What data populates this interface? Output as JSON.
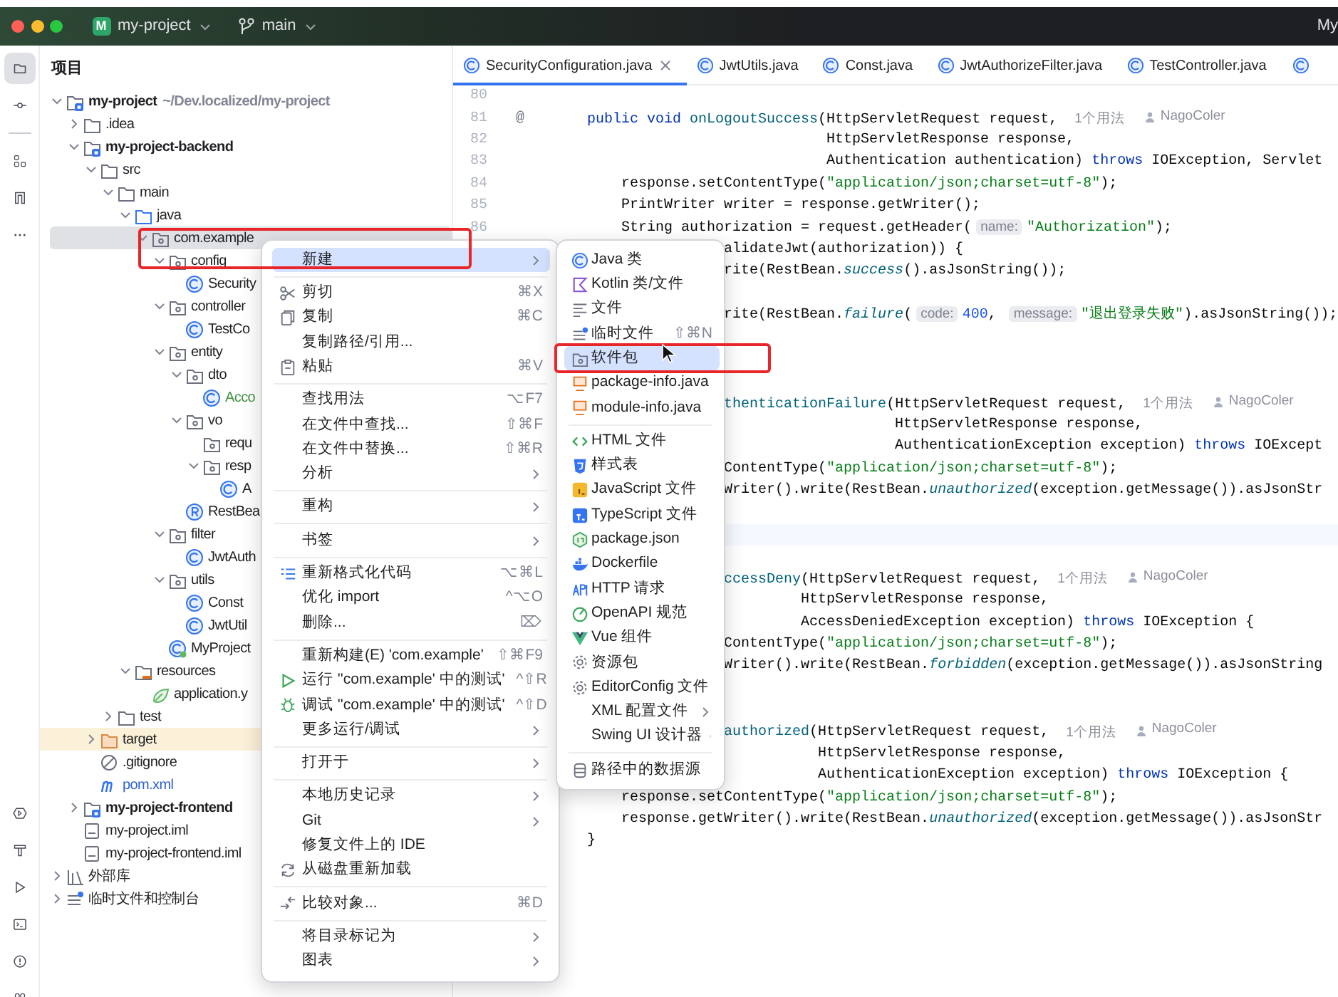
{
  "window": {
    "project_badge": "M",
    "project": "my-project",
    "branch": "main",
    "right_label": "My"
  },
  "tool_strip": {
    "top": [
      {
        "kind": "project",
        "selected": true
      },
      {
        "kind": "commit",
        "selected": false
      },
      {
        "kind": "separator"
      },
      {
        "kind": "structure",
        "selected": false
      },
      {
        "kind": "bookmarks",
        "selected": false
      },
      {
        "kind": "more",
        "selected": false
      }
    ],
    "bottom": [
      {
        "kind": "services",
        "selected": false
      },
      {
        "kind": "build",
        "selected": false
      },
      {
        "kind": "run",
        "selected": false
      },
      {
        "kind": "terminal",
        "selected": false
      },
      {
        "kind": "problems",
        "selected": false
      },
      {
        "kind": "people",
        "selected": false
      }
    ]
  },
  "project_panel": {
    "title": "项目",
    "tree": [
      {
        "label": "my-project",
        "kind": "module",
        "note": "~/Dev.localized/my-project",
        "expanded": true,
        "selected": false,
        "children": [
          {
            "label": ".idea",
            "kind": "folder",
            "expanded": false,
            "selected": false
          },
          {
            "label": "my-project-backend",
            "kind": "module",
            "expanded": true,
            "selected": false,
            "children": [
              {
                "label": "src",
                "kind": "folder",
                "expanded": true,
                "selected": false,
                "children": [
                  {
                    "label": "main",
                    "kind": "folder",
                    "expanded": true,
                    "selected": false,
                    "children": [
                      {
                        "label": "java",
                        "kind": "source",
                        "expanded": true,
                        "selected": false,
                        "children": [
                          {
                            "label": "com.example",
                            "kind": "package",
                            "expanded": true,
                            "selected": true,
                            "children": [
                              {
                                "label": "config",
                                "kind": "package",
                                "expanded": true,
                                "selected": false,
                                "children": [
                                  {
                                    "label": "Security",
                                    "kind": "class",
                                    "selected": false
                                  }
                                ]
                              },
                              {
                                "label": "controller",
                                "kind": "package",
                                "expanded": true,
                                "selected": false,
                                "children": [
                                  {
                                    "label": "TestCo",
                                    "kind": "class",
                                    "selected": false
                                  }
                                ]
                              },
                              {
                                "label": "entity",
                                "kind": "package",
                                "expanded": true,
                                "selected": false,
                                "children": [
                                  {
                                    "label": "dto",
                                    "kind": "package",
                                    "expanded": true,
                                    "selected": false,
                                    "children": [
                                      {
                                        "label": "Acco",
                                        "kind": "class",
                                        "color": "#3f8f3f",
                                        "selected": false
                                      }
                                    ]
                                  },
                                  {
                                    "label": "vo",
                                    "kind": "package",
                                    "expanded": true,
                                    "selected": false,
                                    "children": [
                                      {
                                        "label": "requ",
                                        "kind": "package",
                                        "selected": false
                                      },
                                      {
                                        "label": "resp",
                                        "kind": "package",
                                        "expanded": true,
                                        "selected": false,
                                        "children": [
                                          {
                                            "label": "A",
                                            "kind": "class",
                                            "selected": false
                                          }
                                        ]
                                      }
                                    ]
                                  },
                                  {
                                    "label": "RestBea",
                                    "kind": "record",
                                    "selected": false
                                  }
                                ]
                              },
                              {
                                "label": "filter",
                                "kind": "package",
                                "expanded": true,
                                "selected": false,
                                "children": [
                                  {
                                    "label": "JwtAuth",
                                    "kind": "class",
                                    "selected": false
                                  }
                                ]
                              },
                              {
                                "label": "utils",
                                "kind": "package",
                                "expanded": true,
                                "selected": false,
                                "children": [
                                  {
                                    "label": "Const",
                                    "kind": "class",
                                    "selected": false
                                  },
                                  {
                                    "label": "JwtUtil",
                                    "kind": "class",
                                    "selected": false
                                  }
                                ]
                              },
                              {
                                "label": "MyProject",
                                "kind": "app",
                                "selected": false
                              }
                            ]
                          }
                        ]
                      },
                      {
                        "label": "resources",
                        "kind": "resources",
                        "expanded": true,
                        "selected": false,
                        "children": [
                          {
                            "label": "application.y",
                            "kind": "yaml",
                            "selected": false
                          }
                        ]
                      }
                    ]
                  },
                  {
                    "label": "test",
                    "kind": "folder",
                    "expanded": false,
                    "selected": false
                  }
                ]
              },
              {
                "label": "target",
                "kind": "excluded",
                "expanded": false,
                "selected": false
              },
              {
                "label": ".gitignore",
                "kind": "gitignore",
                "selected": false
              },
              {
                "label": "pom.xml",
                "kind": "maven",
                "color": "#2f62d1",
                "selected": false
              }
            ]
          },
          {
            "label": "my-project-frontend",
            "kind": "module",
            "expanded": false,
            "selected": false
          },
          {
            "label": "my-project.iml",
            "kind": "iml",
            "selected": false
          },
          {
            "label": "my-project-frontend.iml",
            "kind": "iml",
            "selected": false
          }
        ]
      },
      {
        "label": "外部库",
        "kind": "libraries",
        "expanded": false,
        "selected": false
      },
      {
        "label": "临时文件和控制台",
        "kind": "scratches",
        "expanded": false,
        "selected": false
      }
    ]
  },
  "editor": {
    "tabs": [
      {
        "label": "SecurityConfiguration.java",
        "selected": true
      },
      {
        "label": "JwtUtils.java",
        "selected": false
      },
      {
        "label": "Const.java",
        "selected": false
      },
      {
        "label": "JwtAuthorizeFilter.java",
        "selected": false
      },
      {
        "label": "TestController.java",
        "selected": false
      }
    ],
    "gutter": [
      {
        "number": "80"
      },
      {
        "number": "81",
        "marker": "@"
      },
      {
        "number": "82"
      },
      {
        "number": "83"
      },
      {
        "number": "84"
      },
      {
        "number": "85"
      },
      {
        "number": "86"
      }
    ],
    "lines": [
      {
        "kind": "blank"
      },
      {
        "kind": "code",
        "segments": [
          {
            "text": "    public void ",
            "kind": "keyword"
          },
          {
            "text": "onLogoutSuccess",
            "kind": "method"
          },
          {
            "text": "(HttpServletRequest request,",
            "kind": "plain"
          },
          {
            "text": "1个用法",
            "kind": "usage"
          },
          {
            "text": "NagoColer",
            "kind": "author"
          }
        ]
      },
      {
        "kind": "code",
        "segments": [
          {
            "text": "                                HttpServletResponse response,",
            "kind": "plain"
          }
        ]
      },
      {
        "kind": "code",
        "segments": [
          {
            "text": "                                Authentication authentication) ",
            "kind": "plain"
          },
          {
            "text": "throws",
            "kind": "keyword"
          },
          {
            "text": " IOException, Servlet",
            "kind": "plain"
          }
        ]
      },
      {
        "kind": "code",
        "segments": [
          {
            "text": "        response.setContentType(",
            "kind": "plain"
          },
          {
            "text": "\"application/json;charset=utf-8\"",
            "kind": "string"
          },
          {
            "text": ");",
            "kind": "plain"
          }
        ]
      },
      {
        "kind": "code",
        "segments": [
          {
            "text": "        PrintWriter writer = response.getWriter();",
            "kind": "plain"
          }
        ]
      },
      {
        "kind": "code",
        "segments": [
          {
            "text": "        String authorization = request.getHeader(",
            "kind": "plain"
          },
          {
            "text": "name:",
            "kind": "hint"
          },
          {
            "text": "\"Authorization\"",
            "kind": "string"
          },
          {
            "text": ");",
            "kind": "plain"
          }
        ]
      },
      {
        "kind": "code",
        "segments": [
          {
            "text": "                    alidateJwt(authorization)) {",
            "kind": "plain"
          }
        ]
      },
      {
        "kind": "code",
        "segments": [
          {
            "text": "                    rite(RestBean.",
            "kind": "plain"
          },
          {
            "text": "success",
            "kind": "static"
          },
          {
            "text": "().asJsonString());",
            "kind": "plain"
          }
        ]
      },
      {
        "kind": "blank"
      },
      {
        "kind": "code",
        "segments": [
          {
            "text": "                    rite(RestBean.",
            "kind": "plain"
          },
          {
            "text": "failure",
            "kind": "static"
          },
          {
            "text": "(",
            "kind": "plain"
          },
          {
            "text": "code:",
            "kind": "hint"
          },
          {
            "text": "400",
            "kind": "number"
          },
          {
            "text": ", ",
            "kind": "plain"
          },
          {
            "text": "message:",
            "kind": "hint"
          },
          {
            "text": "\"退出登录失败\"",
            "kind": "string"
          },
          {
            "text": ").asJsonString());",
            "kind": "plain"
          }
        ]
      },
      {
        "kind": "blank"
      },
      {
        "kind": "blank"
      },
      {
        "kind": "blank"
      },
      {
        "kind": "code",
        "segments": [
          {
            "text": "                    thenticationFailure",
            "kind": "method"
          },
          {
            "text": "(HttpServletRequest request,",
            "kind": "plain"
          },
          {
            "text": "1个用法",
            "kind": "usage"
          },
          {
            "text": "NagoColer",
            "kind": "author"
          }
        ]
      },
      {
        "kind": "code",
        "segments": [
          {
            "text": "                                        HttpServletResponse response,",
            "kind": "plain"
          }
        ]
      },
      {
        "kind": "code",
        "segments": [
          {
            "text": "                                        AuthenticationException exception) ",
            "kind": "plain"
          },
          {
            "text": "throws",
            "kind": "keyword"
          },
          {
            "text": " IOExcept",
            "kind": "plain"
          }
        ]
      },
      {
        "kind": "code",
        "segments": [
          {
            "text": "                    ContentType(",
            "kind": "plain"
          },
          {
            "text": "\"application/json;charset=utf-8\"",
            "kind": "string"
          },
          {
            "text": ");",
            "kind": "plain"
          }
        ]
      },
      {
        "kind": "code",
        "segments": [
          {
            "text": "                    Writer().write(RestBean.",
            "kind": "plain"
          },
          {
            "text": "unauthorized",
            "kind": "static"
          },
          {
            "text": "(exception.getMessage()).asJsonStr",
            "kind": "plain"
          }
        ]
      },
      {
        "kind": "blank"
      },
      {
        "kind": "blank",
        "current": true
      },
      {
        "kind": "blank"
      },
      {
        "kind": "code",
        "segments": [
          {
            "text": "                    ccessDeny",
            "kind": "method"
          },
          {
            "text": "(HttpServletRequest request,",
            "kind": "plain"
          },
          {
            "text": "1个用法",
            "kind": "usage"
          },
          {
            "text": "NagoColer",
            "kind": "author"
          }
        ]
      },
      {
        "kind": "code",
        "segments": [
          {
            "text": "                             HttpServletResponse response,",
            "kind": "plain"
          }
        ]
      },
      {
        "kind": "code",
        "segments": [
          {
            "text": "                             AccessDeniedException exception) ",
            "kind": "plain"
          },
          {
            "text": "throws",
            "kind": "keyword"
          },
          {
            "text": " IOException {",
            "kind": "plain"
          }
        ]
      },
      {
        "kind": "code",
        "segments": [
          {
            "text": "                    ContentType(",
            "kind": "plain"
          },
          {
            "text": "\"application/json;charset=utf-8\"",
            "kind": "string"
          },
          {
            "text": ");",
            "kind": "plain"
          }
        ]
      },
      {
        "kind": "code",
        "segments": [
          {
            "text": "                    Writer().write(RestBean.",
            "kind": "plain"
          },
          {
            "text": "forbidden",
            "kind": "static"
          },
          {
            "text": "(exception.getMessage()).asJsonString",
            "kind": "plain"
          }
        ]
      },
      {
        "kind": "blank"
      },
      {
        "kind": "blank"
      },
      {
        "kind": "code",
        "segments": [
          {
            "text": "                    authorized",
            "kind": "method"
          },
          {
            "text": "(HttpServletRequest request,",
            "kind": "plain"
          },
          {
            "text": "1个用法",
            "kind": "usage"
          },
          {
            "text": "NagoColer",
            "kind": "author"
          }
        ]
      },
      {
        "kind": "code",
        "segments": [
          {
            "text": "                               HttpServletResponse response,",
            "kind": "plain"
          }
        ]
      },
      {
        "kind": "code",
        "segments": [
          {
            "text": "                               AuthenticationException exception) ",
            "kind": "plain"
          },
          {
            "text": "throws",
            "kind": "keyword"
          },
          {
            "text": " IOException {",
            "kind": "plain"
          }
        ]
      },
      {
        "kind": "code",
        "segments": [
          {
            "text": "        response.setContentType(",
            "kind": "plain"
          },
          {
            "text": "\"application/json;charset=utf-8\"",
            "kind": "string"
          },
          {
            "text": ");",
            "kind": "plain"
          }
        ]
      },
      {
        "kind": "code",
        "segments": [
          {
            "text": "        response.getWriter().write(RestBean.",
            "kind": "plain"
          },
          {
            "text": "unauthorized",
            "kind": "static"
          },
          {
            "text": "(exception.getMessage()).asJsonStr",
            "kind": "plain"
          }
        ]
      },
      {
        "kind": "code",
        "segments": [
          {
            "text": "    }",
            "kind": "plain"
          }
        ]
      }
    ]
  },
  "context_menu": [
    {
      "kind": "plain",
      "label": "新建",
      "submenu": true,
      "selected": true
    },
    {
      "kind": "separator"
    },
    {
      "kind": "cut",
      "label": "剪切",
      "shortcut": "⌘X",
      "selected": false
    },
    {
      "kind": "copy",
      "label": "复制",
      "shortcut": "⌘C",
      "selected": false
    },
    {
      "kind": "plain",
      "label": "复制路径/引用...",
      "selected": false
    },
    {
      "kind": "paste",
      "label": "粘贴",
      "shortcut": "⌘V",
      "selected": false
    },
    {
      "kind": "separator"
    },
    {
      "kind": "plain",
      "label": "查找用法",
      "shortcut": "⌥F7",
      "selected": false
    },
    {
      "kind": "plain",
      "label": "在文件中查找...",
      "shortcut": "⇧⌘F",
      "selected": false
    },
    {
      "kind": "plain",
      "label": "在文件中替换...",
      "shortcut": "⇧⌘R",
      "selected": false
    },
    {
      "kind": "plain",
      "label": "分析",
      "submenu": true,
      "selected": false
    },
    {
      "kind": "separator"
    },
    {
      "kind": "plain",
      "label": "重构",
      "submenu": true,
      "selected": false
    },
    {
      "kind": "separator"
    },
    {
      "kind": "plain",
      "label": "书签",
      "submenu": true,
      "selected": false
    },
    {
      "kind": "separator"
    },
    {
      "kind": "reformat",
      "label": "重新格式化代码",
      "shortcut": "⌥⌘L",
      "selected": false
    },
    {
      "kind": "plain",
      "label": "优化 import",
      "shortcut": "^⌥O",
      "selected": false
    },
    {
      "kind": "plain",
      "label": "删除...",
      "shortcut": "⌦",
      "selected": false
    },
    {
      "kind": "separator"
    },
    {
      "kind": "plain",
      "label": "重新构建(E) 'com.example'",
      "shortcut": "⇧⌘F9",
      "selected": false
    },
    {
      "kind": "run",
      "label": "运行 ''com.example' 中的测试'",
      "shortcut": "^⇧R",
      "selected": false
    },
    {
      "kind": "debug",
      "label": "调试 ''com.example' 中的测试'",
      "shortcut": "^⇧D",
      "selected": false
    },
    {
      "kind": "plain",
      "label": "更多运行/调试",
      "submenu": true,
      "selected": false
    },
    {
      "kind": "separator"
    },
    {
      "kind": "plain",
      "label": "打开于",
      "submenu": true,
      "selected": false
    },
    {
      "kind": "separator"
    },
    {
      "kind": "plain",
      "label": "本地历史记录",
      "submenu": true,
      "selected": false
    },
    {
      "kind": "plain",
      "label": "Git",
      "submenu": true,
      "selected": false
    },
    {
      "kind": "plain",
      "label": "修复文件上的 IDE",
      "selected": false
    },
    {
      "kind": "reload",
      "label": "从磁盘重新加载",
      "selected": false
    },
    {
      "kind": "separator"
    },
    {
      "kind": "compare",
      "label": "比较对象...",
      "shortcut": "⌘D",
      "selected": false
    },
    {
      "kind": "separator"
    },
    {
      "kind": "plain",
      "label": "将目录标记为",
      "submenu": true,
      "selected": false
    },
    {
      "kind": "plain",
      "label": "图表",
      "submenu": true,
      "selected": false
    }
  ],
  "new_submenu": [
    {
      "kind": "class",
      "label": "Java 类",
      "selected": false
    },
    {
      "kind": "kotlin",
      "label": "Kotlin 类/文件",
      "selected": false
    },
    {
      "kind": "text",
      "label": "文件",
      "selected": false
    },
    {
      "kind": "scratch",
      "label": "临时文件",
      "shortcut": "⇧⌘N",
      "selected": false
    },
    {
      "kind": "package",
      "label": "软件包",
      "selected": true
    },
    {
      "kind": "javafile",
      "label": "package-info.java",
      "selected": false
    },
    {
      "kind": "javafile",
      "label": "module-info.java",
      "selected": false
    },
    {
      "kind": "separator"
    },
    {
      "kind": "html",
      "label": "HTML 文件",
      "selected": false
    },
    {
      "kind": "css",
      "label": "样式表",
      "selected": false
    },
    {
      "kind": "js",
      "label": "JavaScript 文件",
      "selected": false
    },
    {
      "kind": "ts",
      "label": "TypeScript 文件",
      "selected": false
    },
    {
      "kind": "node",
      "label": "package.json",
      "selected": false
    },
    {
      "kind": "docker",
      "label": "Dockerfile",
      "selected": false
    },
    {
      "kind": "http",
      "label": "HTTP 请求",
      "selected": false
    },
    {
      "kind": "openapi",
      "label": "OpenAPI 规范",
      "selected": false
    },
    {
      "kind": "vue",
      "label": "Vue 组件",
      "selected": false
    },
    {
      "kind": "gear",
      "label": "资源包",
      "selected": false
    },
    {
      "kind": "gear",
      "label": "EditorConfig 文件",
      "selected": false
    },
    {
      "kind": "plain",
      "label": "XML 配置文件",
      "submenu": true,
      "selected": false
    },
    {
      "kind": "plain",
      "label": "Swing UI 设计器",
      "submenu": true,
      "selected": false
    },
    {
      "kind": "separator"
    },
    {
      "kind": "database",
      "label": "路径中的数据源",
      "selected": false
    }
  ]
}
